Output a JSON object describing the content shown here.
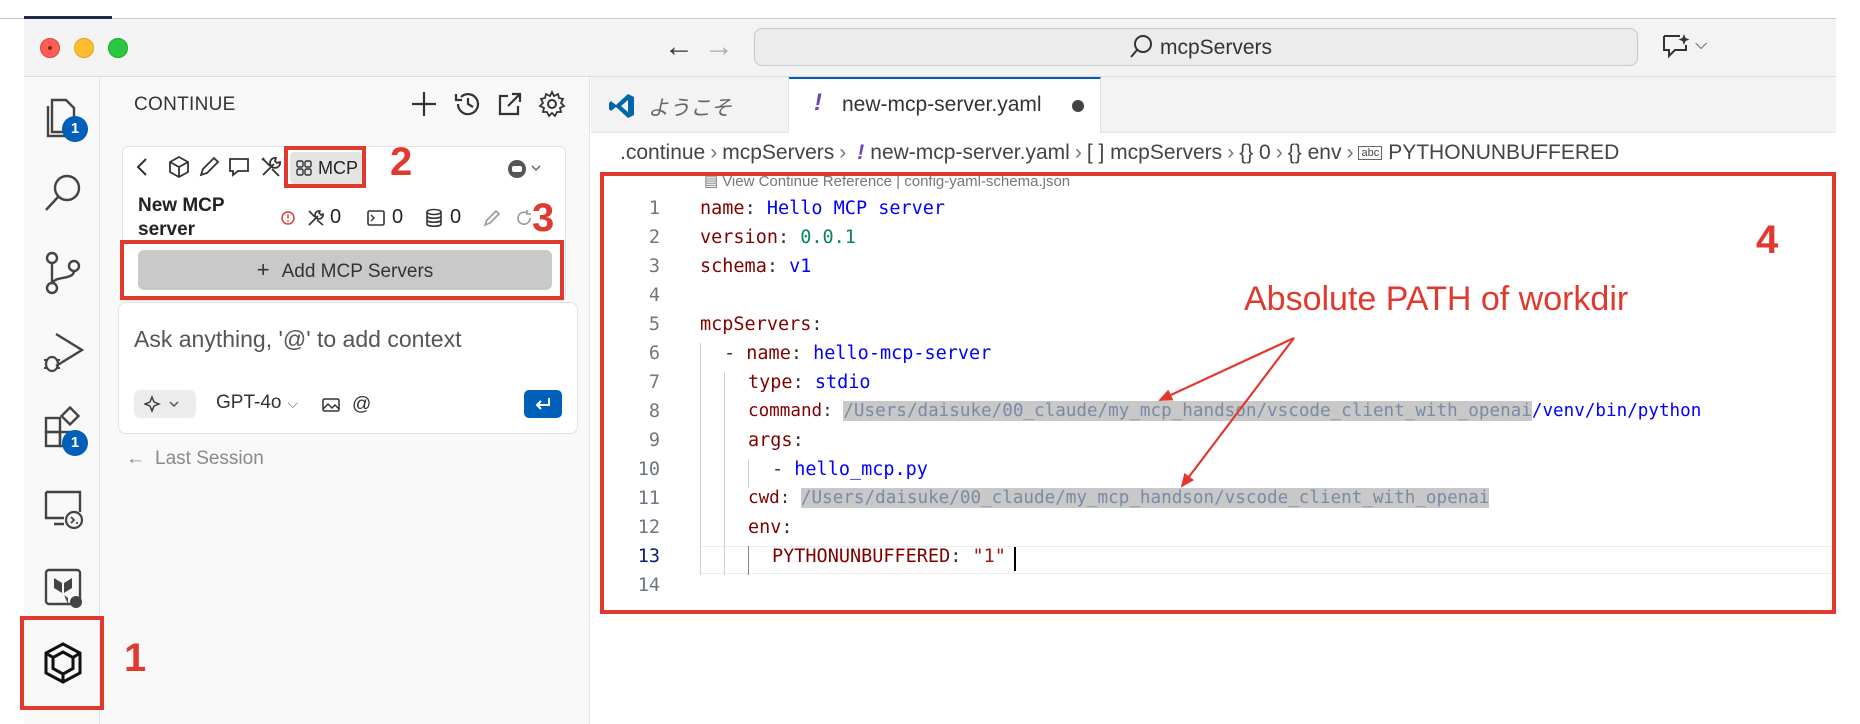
{
  "window": {
    "search_text": "mcpServers",
    "nav_back": "←",
    "nav_forward": "→"
  },
  "activity_bar": {
    "items": [
      {
        "icon": "explorer-icon",
        "badge": "1"
      },
      {
        "icon": "search-icon"
      },
      {
        "icon": "source-control-icon"
      },
      {
        "icon": "run-debug-icon"
      },
      {
        "icon": "extensions-icon",
        "badge": "1"
      },
      {
        "icon": "remote-explorer-icon"
      },
      {
        "icon": "terraform-icon"
      },
      {
        "icon": "continue-icon"
      }
    ]
  },
  "sidebar": {
    "title": "CONTINUE",
    "mcp_tab_label": "MCP",
    "server_name": "New MCP server",
    "tools_count": "0",
    "prompts_count": "0",
    "resources_count": "0",
    "add_button_label": "Add MCP Servers",
    "chat_placeholder": "Ask anything, '@' to add context",
    "model_label": "GPT-4o",
    "last_session_label": "Last Session"
  },
  "editor": {
    "tabs": [
      {
        "label": "ようこそ",
        "active": false
      },
      {
        "label": "new-mcp-server.yaml",
        "active": true,
        "modified": true
      }
    ],
    "breadcrumbs": [
      ".continue",
      "mcpServers",
      "new-mcp-server.yaml",
      "[ ] mcpServers",
      "{} 0",
      "{} env",
      "PYTHONUNBUFFERED"
    ],
    "codelens": "View Continue Reference | config-yaml-schema.json",
    "active_line": 13,
    "line_numbers": [
      "1",
      "2",
      "3",
      "4",
      "5",
      "6",
      "7",
      "8",
      "9",
      "10",
      "11",
      "12",
      "13",
      "14"
    ],
    "code": {
      "l1_key": "name",
      "l1_val": "Hello MCP server",
      "l2_key": "version",
      "l2_val": "0.0.1",
      "l3_key": "schema",
      "l3_val": "v1",
      "l5_key": "mcpServers",
      "l6_key": "name",
      "l6_val": "hello-mcp-server",
      "l7_key": "type",
      "l7_val": "stdio",
      "l8_key": "command",
      "l8_val_hl": "/Users/daisuke/00_claude/my_mcp_handson/vscode_client_with_openai",
      "l8_val_rest": "/venv/bin/python",
      "l9_key": "args",
      "l10_val": "hello_mcp.py",
      "l11_key": "cwd",
      "l11_val_hl": "/Users/daisuke/00_claude/my_mcp_handson/vscode_client_with_openai",
      "l12_key": "env",
      "l13_key": "PYTHONUNBUFFERED",
      "l13_val": "\"1\""
    }
  },
  "annotations": {
    "n1": "1",
    "n2": "2",
    "n3": "3",
    "n4": "4",
    "note": "Absolute PATH of workdir",
    "color": "#e03a2f"
  },
  "colors": {
    "accent": "#005fb8",
    "yaml_key": "#800000",
    "yaml_value": "#0000ff",
    "yaml_number": "#098658"
  }
}
